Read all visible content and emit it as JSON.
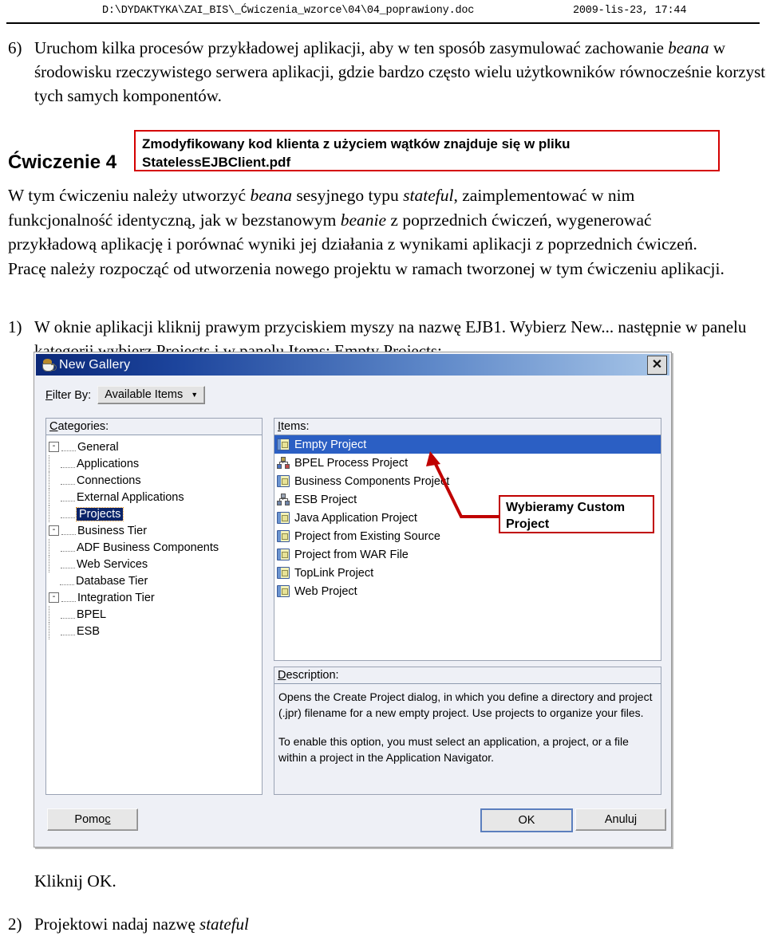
{
  "header": {
    "path": "D:\\DYDAKTYKA\\ZAI_BIS\\_Ćwiczenia_wzorce\\04\\04_poprawiony.doc",
    "date": "2009-lis-23, 17:44"
  },
  "content": {
    "item6_marker": "6)",
    "item6_text": "Uruchom kilka procesów przykładowej aplikacji, aby w ten sposób zasymulować zachowanie beana w środowisku rzeczywistego serwera aplikacji, gdzie bardzo często wielu użytkowników równocześnie korzysta z tych samych komponentów.",
    "item6_part1": "Uruchom kilka procesów przykładowej aplikacji, aby w ten sposób zasymulować zachowanie ",
    "item6_italic": "beana",
    "item6_part2": " w środowisku rzeczywistego serwera aplikacji, gdzie bardzo często wielu użytkowników równocześnie korzysta z tych samych komponentów.",
    "exercise_heading": "Ćwiczenie 4",
    "note1_line1": "Zmodyfikowany kod klienta z użyciem wątków znajduje się w pliku",
    "note1_line2": "StatelessEJBClient.pdf",
    "para_main_1": "W tym ćwiczeniu należy utworzyć ",
    "para_main_i1": "beana",
    "para_main_2": " sesyjnego typu ",
    "para_main_i2": "stateful",
    "para_main_3": ", zaimplementować w nim funkcjonalność identyczną, jak w bezstanowym ",
    "para_main_i3": "beanie",
    "para_main_4": " z poprzednich ćwiczeń, wygenerować przykładową aplikację i porównać wyniki jej działania z wynikami aplikacji z poprzednich ćwiczeń. Pracę należy rozpocząć od utworzenia nowego projektu w ramach tworzonej w tym ćwiczeniu aplikacji.",
    "item1_marker": "1)",
    "item1_text": "W oknie aplikacji kliknij prawym przyciskiem myszy na nazwę EJB1. Wybierz New... następnie w panelu kategorii wybierz Projects i w panelu Items: Empty Projects:",
    "kliknij_ok": "Kliknij OK.",
    "item2_marker": "2)",
    "item2_part1": "Projektowi nadaj nazwę ",
    "item2_italic": "stateful"
  },
  "dialog": {
    "title": "New Gallery",
    "close_label": "✕",
    "filter_label_underlined": "F",
    "filter_label_rest": "ilter By:",
    "filter_value": "Available Items",
    "filter_caret": "▼",
    "categories_label_underlined": "C",
    "categories_label_rest": "ategories:",
    "items_label_underlined": "I",
    "items_label_rest": "tems:",
    "description_label_underlined": "D",
    "description_label_rest": "escription:",
    "categories": [
      {
        "label": "General",
        "level": 0,
        "expander": "-",
        "selected": false
      },
      {
        "label": "Applications",
        "level": 1,
        "expander": "",
        "selected": false
      },
      {
        "label": "Connections",
        "level": 1,
        "expander": "",
        "selected": false
      },
      {
        "label": "External Applications",
        "level": 1,
        "expander": "",
        "selected": false
      },
      {
        "label": "Projects",
        "level": 1,
        "expander": "",
        "selected": true
      },
      {
        "label": "Business Tier",
        "level": 0,
        "expander": "-",
        "selected": false
      },
      {
        "label": "ADF Business Components",
        "level": 1,
        "expander": "",
        "selected": false
      },
      {
        "label": "Web Services",
        "level": 1,
        "expander": "",
        "selected": false
      },
      {
        "label": "Database Tier",
        "level": 0,
        "expander": "",
        "selected": false
      },
      {
        "label": "Integration Tier",
        "level": 0,
        "expander": "-",
        "selected": false
      },
      {
        "label": "BPEL",
        "level": 1,
        "expander": "",
        "selected": false
      },
      {
        "label": "ESB",
        "level": 1,
        "expander": "",
        "selected": false
      }
    ],
    "items": [
      {
        "label": "Empty Project",
        "icon": "folder-icon",
        "selected": true
      },
      {
        "label": "BPEL Process Project",
        "icon": "hierarchy-icon",
        "selected": false
      },
      {
        "label": "Business Components Project",
        "icon": "folder-icon",
        "selected": false
      },
      {
        "label": "ESB Project",
        "icon": "hierarchy-grey-icon",
        "selected": false
      },
      {
        "label": "Java Application Project",
        "icon": "folder-icon",
        "selected": false
      },
      {
        "label": "Project from Existing Source",
        "icon": "folder-icon",
        "selected": false
      },
      {
        "label": "Project from WAR File",
        "icon": "folder-icon",
        "selected": false
      },
      {
        "label": "TopLink Project",
        "icon": "folder-icon",
        "selected": false
      },
      {
        "label": "Web Project",
        "icon": "folder-icon",
        "selected": false
      }
    ],
    "description_p1": "Opens the Create Project dialog, in which you define a directory and project (.jpr) filename for a new empty project. Use projects to organize your files.",
    "description_p2": "To enable this option, you must select an application, a project, or a file within a project in the Application Navigator.",
    "btn_help_underlined_pre": "Pomo",
    "btn_help_underlined": "c",
    "btn_ok": "OK",
    "btn_cancel": "Anuluj"
  },
  "annotation": {
    "note2_line1": "Wybieramy Custom",
    "note2_line2": "Project",
    "box_color": "#c00000",
    "arrow_color": "#c00000"
  }
}
